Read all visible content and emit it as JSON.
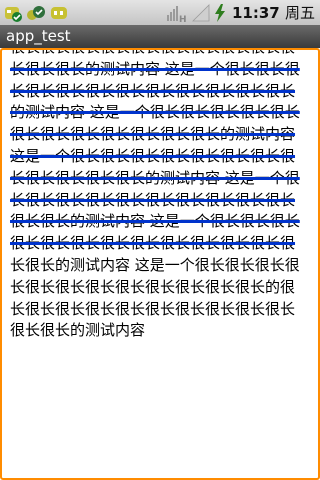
{
  "status_bar": {
    "notification_icons": [
      "app-notification-icon-1",
      "app-notification-icon-2",
      "app-notification-icon-3"
    ],
    "network_type": "H",
    "time": "11:37",
    "weekday": "周五"
  },
  "app": {
    "title": "app_test"
  },
  "content": {
    "struck_text": "很长很长很长很长很长很长很长很长很长很长很长很长的测试内容 这是一个很长很长很长很长很长很长很长很长很长很长很长很长的测试内容 这是一个很长很长很长很长很长很长很长很长很长很长很长很长的测试内容 这是一个很长很长很长很长很长很长很长很长很长很长很长很长的测试内容 这是一个很长很长很长很长很长很长很长很长很长很长很长很长的测试内容 这是一个很长很长很长很长很长很长很长很长很长很长很长很长很",
    "plain_text": "长很长的测试内容 这是一个很长很长很长很长很长很长很长很长很长很长很长很长的很长很长很长很长很长很长很长很长很长很长很长很长的测试内容"
  },
  "colors": {
    "strike": "#0033cc",
    "focus_border": "#ff8c00",
    "title_bar": "#4a4a4a"
  }
}
